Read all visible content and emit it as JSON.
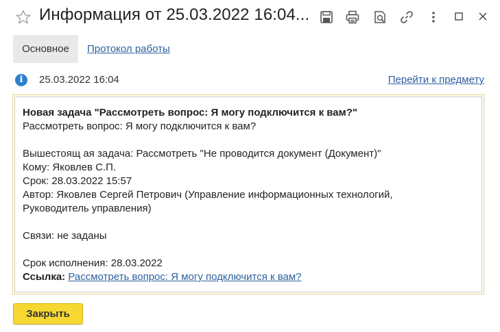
{
  "window": {
    "title": "Информация от 25.03.2022 16:04..."
  },
  "toolbar": {
    "icons": [
      "save-icon",
      "print-icon",
      "preview-icon",
      "link-icon",
      "more-icon"
    ],
    "window_controls": [
      "minimize-icon",
      "maximize-icon",
      "close-icon"
    ]
  },
  "tabs": [
    {
      "label": "Основное",
      "active": true
    },
    {
      "label": "Протокол работы",
      "active": false
    }
  ],
  "info": {
    "date": "25.03.2022 16:04",
    "goto_link": "Перейти к предмету"
  },
  "message": {
    "heading": "Новая задача \"Рассмотреть вопрос: Я могу подключится к вам?\"",
    "subtitle": "Рассмотреть вопрос: Я могу подключится к вам?",
    "parent_task": "Вышестоящ ая задача: Рассмотреть \"Не проводится документ (Документ)\"",
    "to": "Кому: Яковлев С.П.",
    "deadline": "Срок: 28.03.2022 15:57",
    "author_line1": "Автор: Яковлев Сергей Петрович (Управление информационных технологий,",
    "author_line2": "Руководитель управления)",
    "links": "Связи: не заданы",
    "due": "Срок исполнения: 28.03.2022",
    "ref_label": "Ссылка:",
    "ref_link": "Рассмотреть вопрос: Я могу подключится к вам?"
  },
  "buttons": {
    "close": "Закрыть"
  },
  "colors": {
    "accent_button": "#f7d832",
    "link": "#2d5ea0",
    "info_icon": "#2f7fd1",
    "frame_border": "#e3d27a"
  }
}
